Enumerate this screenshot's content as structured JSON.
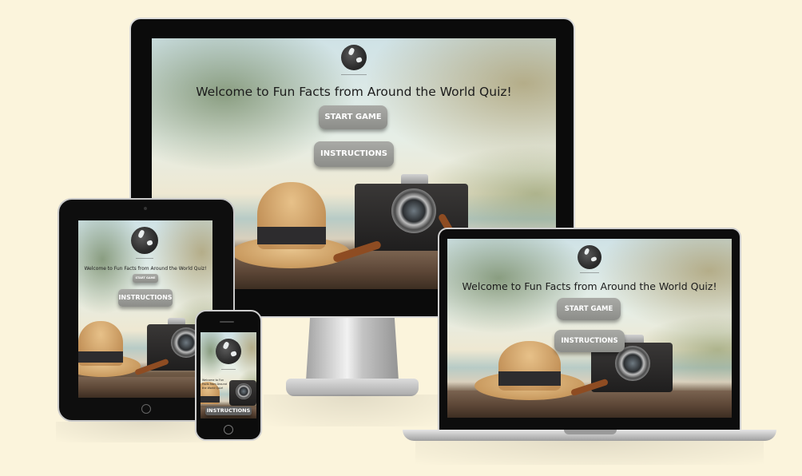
{
  "quiz": {
    "title": "Welcome to Fun Facts from Around the World Quiz!",
    "start_label": "START GAME",
    "instructions_label": "INSTRUCTIONS",
    "logo_icon": "globe-icon"
  },
  "phone": {
    "title_fragment": "Welcome to Fun Facts from Around the World Quiz!"
  },
  "colors": {
    "background": "#fbf4dc",
    "button": "#9a9b97",
    "title": "#1c1c1c"
  }
}
